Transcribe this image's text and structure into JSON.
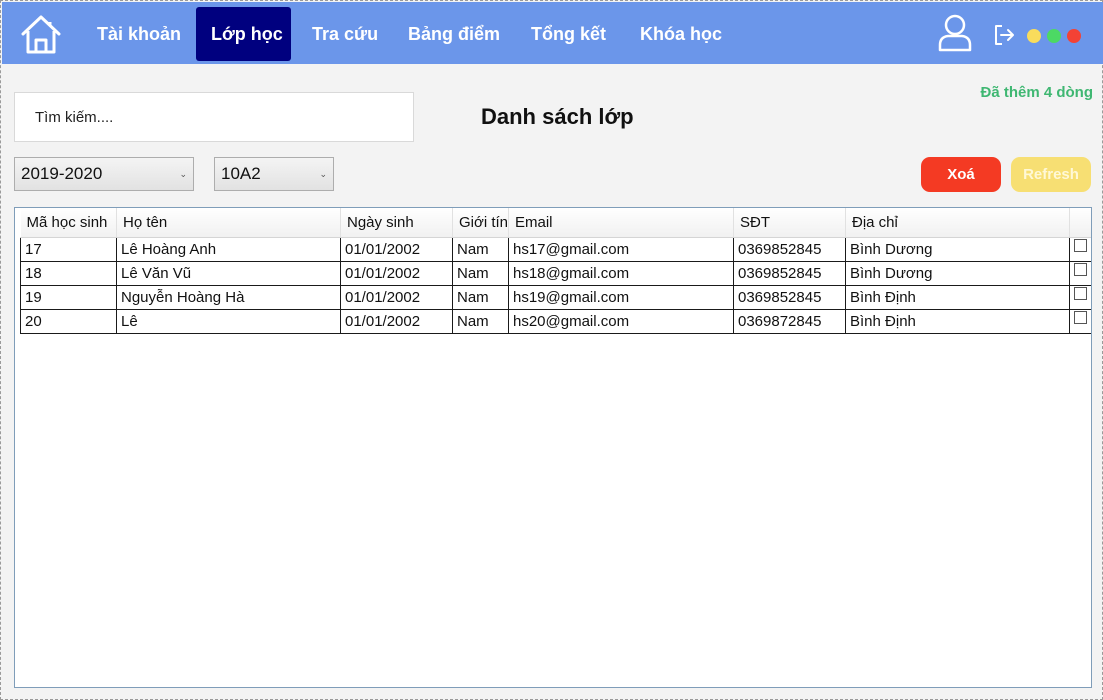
{
  "nav": {
    "items": [
      {
        "label": "Tài khoản",
        "active": false
      },
      {
        "label": "Lớp học",
        "active": true
      },
      {
        "label": "Tra cứu",
        "active": false
      },
      {
        "label": "Bảng điểm",
        "active": false
      },
      {
        "label": "Tổng kết",
        "active": false
      },
      {
        "label": "Khóa học",
        "active": false
      }
    ],
    "icons": {
      "home": "home-icon",
      "user": "user-icon",
      "logout": "logout-icon"
    },
    "window_dots": [
      "#f9dc5c",
      "#4cd964",
      "#f34235"
    ],
    "bar_color": "#6b96ea",
    "active_color": "#00007f"
  },
  "search": {
    "placeholder": "Tìm kiếm...."
  },
  "page": {
    "title": "Danh sách lớp",
    "status": "Đã thêm 4 dòng",
    "status_color": "#3fb772"
  },
  "filters": {
    "year": "2019-2020",
    "class": "10A2"
  },
  "actions": {
    "delete_label": "Xoá",
    "refresh_label": "Refresh",
    "delete_color": "#f43a23",
    "refresh_color": "#f7df73"
  },
  "table": {
    "columns": [
      "Mã học sinh",
      "Họ tên",
      "Ngày sinh",
      "Giới tính",
      "Email",
      "SĐT",
      "Địa chỉ",
      ""
    ],
    "rows": [
      {
        "id": "17",
        "name": "Lê Hoàng Anh",
        "dob": "01/01/2002",
        "gender": "Nam",
        "email": "hs17@gmail.com",
        "phone": "0369852845",
        "address": "Bình Dương",
        "checked": false
      },
      {
        "id": "18",
        "name": "Lê Văn Vũ",
        "dob": "01/01/2002",
        "gender": "Nam",
        "email": "hs18@gmail.com",
        "phone": "0369852845",
        "address": "Bình Dương",
        "checked": false
      },
      {
        "id": "19",
        "name": "Nguyễn Hoàng Hà",
        "dob": "01/01/2002",
        "gender": "Nam",
        "email": "hs19@gmail.com",
        "phone": "0369852845",
        "address": "Bình Định",
        "checked": false
      },
      {
        "id": "20",
        "name": "Lê",
        "dob": "01/01/2002",
        "gender": "Nam",
        "email": "hs20@gmail.com",
        "phone": "0369872845",
        "address": "Bình Định",
        "checked": false
      }
    ]
  }
}
